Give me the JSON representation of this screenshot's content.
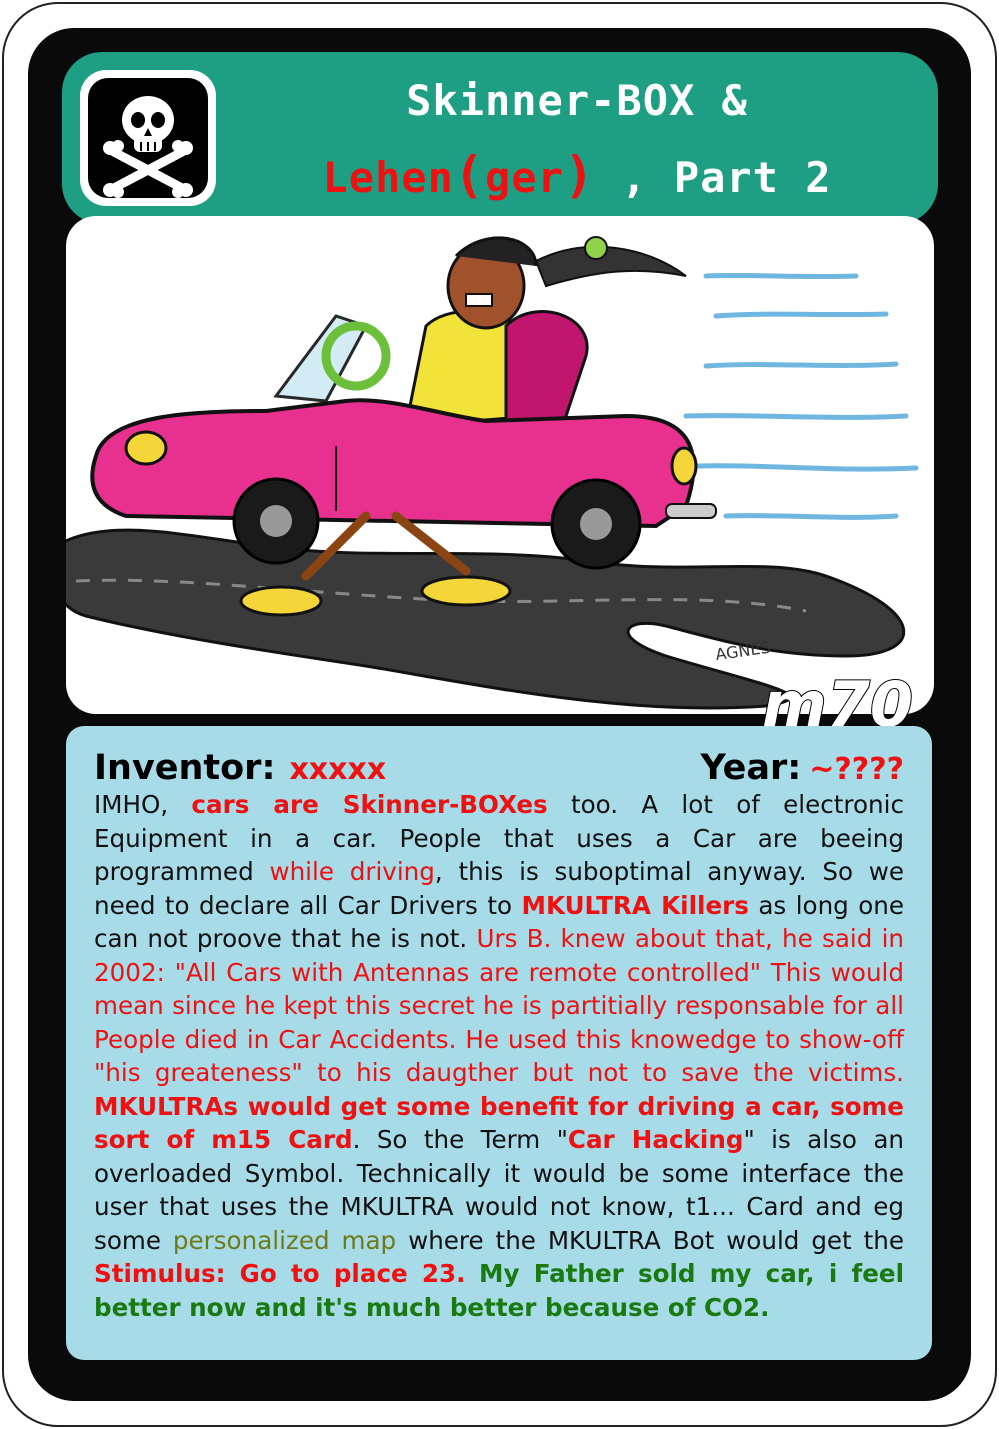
{
  "card": {
    "title_line1": "Skinner-BOX &",
    "title_line2_red": "Lehen",
    "title_line2_paren_open": "(",
    "title_line2_paren_word": "ger",
    "title_line2_paren_close": ")",
    "title_line2_rest": ", Part 2",
    "code": "m70",
    "icon": "skull-crossbones-icon",
    "signature": "AGNES"
  },
  "meta": {
    "inventor_label": "Inventor:",
    "inventor_value": "xxxxx",
    "year_label": "Year:",
    "year_value": "~????"
  },
  "body": {
    "s1": "IMHO, ",
    "s2": "cars are Skinner-BOXes",
    "s3": " too. A lot of electronic Equipment in a car. People that uses a Car are beeing programmed ",
    "s4": "while driving",
    "s5": ", this is suboptimal anyway. So we need to declare all Car Drivers to ",
    "s6": "MKULTRA Killers",
    "s7": " as long one can not proove that he is not. ",
    "s8": "Urs B. knew about that, he said in 2002: \"All Cars with Antennas are remote controlled\" This would mean since he kept this secret he is partitially responsable for all People died in Car Accidents. He used this knowedge to show-off \"his greateness\" to his daugther but not to save the victims. ",
    "s9": "MKULTRAs would get some benefit for driving a car, some sort of m15 Card",
    "s10": ". So the Term \"",
    "s11": "Car Hacking",
    "s12": "\" is also an overloaded Symbol. Technically it would be some interface the user that uses the MKULTRA would not know, t1... Card and eg some ",
    "s13": "personalized map",
    "s14": " where the MKULTRA Bot would get the ",
    "s15": "Stimulus: Go to place 23.",
    "s16": " ",
    "s17": "My Father sold my car, i feel better now and it's much better because of CO2."
  },
  "colors": {
    "title_bar": "#1e9f84",
    "text_panel": "#a8dbe8",
    "accent_red": "#ee1111",
    "accent_green": "#1a7a12",
    "accent_olive": "#6e7a1a",
    "car_pink": "#e8318f"
  }
}
